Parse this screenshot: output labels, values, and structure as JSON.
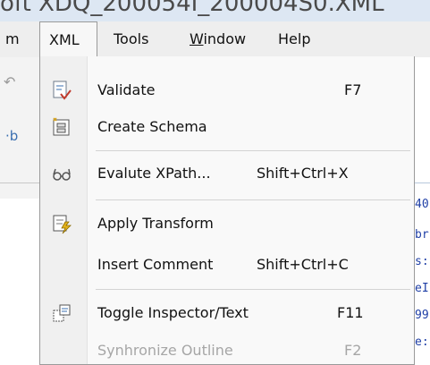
{
  "window": {
    "title_partial": "oft  XDQ_200054I_200004S0.XML"
  },
  "menubar": {
    "items": [
      {
        "label": "m"
      },
      {
        "label": "XML"
      },
      {
        "label": "Tools"
      },
      {
        "label_prefix": "",
        "label_mnemonic": "W",
        "label_suffix": "indow"
      },
      {
        "label": "Help"
      }
    ]
  },
  "background": {
    "left_glyph_top": "↶",
    "left_glyph_mid": "·b",
    "right_code": [
      "40",
      "br",
      "s:",
      "eI",
      "99",
      "e:"
    ]
  },
  "xml_menu": {
    "items": [
      {
        "label": "Validate",
        "shortcut": "F7",
        "icon": "validate-icon",
        "enabled": true
      },
      {
        "label": "Create Schema",
        "shortcut": "",
        "icon": "schema-icon",
        "enabled": true
      },
      {
        "label": "Evalute XPath...",
        "shortcut": "Shift+Ctrl+X",
        "icon": "glasses-icon",
        "enabled": true
      },
      {
        "label": "Apply Transform",
        "shortcut": "",
        "icon": "transform-icon",
        "enabled": true
      },
      {
        "label": "Insert Comment",
        "shortcut": "Shift+Ctrl+C",
        "icon": "",
        "enabled": true
      },
      {
        "label": "Toggle Inspector/Text",
        "shortcut": "F11",
        "icon": "inspector-icon",
        "enabled": true
      },
      {
        "label": "Synhronize Outline",
        "shortcut": "F2",
        "icon": "",
        "enabled": false
      }
    ]
  },
  "colors": {
    "menubar_bg": "#eeeeee",
    "menu_bg": "#f9f9f9",
    "disabled_text": "#a6a6a6",
    "titlebar_bg": "#dde7f3"
  }
}
